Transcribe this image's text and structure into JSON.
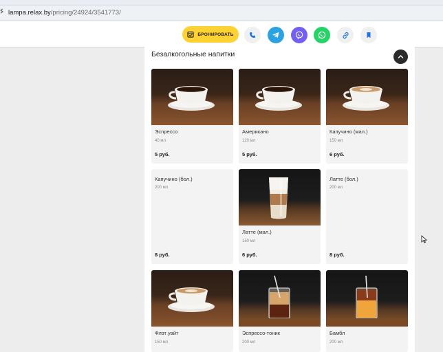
{
  "browser": {
    "url_host": "lampa.relax.by",
    "url_path": "/pricing/24924/3541773/"
  },
  "header": {
    "book_label": "БРОНИРОВАТЬ",
    "icons": [
      "phone-icon",
      "telegram-icon",
      "viber-icon",
      "whatsapp-icon",
      "link-icon",
      "bookmark-icon"
    ]
  },
  "section": {
    "title": "Безалкогольные напитки"
  },
  "items": [
    {
      "name": "Эспрессо",
      "volume": "40 мл",
      "price": "5 руб.",
      "photo": "coffee-cup"
    },
    {
      "name": "Американо",
      "volume": "120 мл",
      "price": "5 руб.",
      "photo": "coffee-cup"
    },
    {
      "name": "Капучино (мал.)",
      "volume": "150 мл",
      "price": "6 руб.",
      "photo": "latte-cup"
    },
    {
      "name": "Капучино (бол.)",
      "volume": "200 мл",
      "price": "8 руб.",
      "photo": ""
    },
    {
      "name": "Латте (мал.)",
      "volume": "150 мл",
      "price": "6 руб.",
      "photo": "latte-glass"
    },
    {
      "name": "Латте (бол.)",
      "volume": "200 мл",
      "price": "8 руб.",
      "photo": ""
    },
    {
      "name": "Флэт уайт",
      "volume": "150 мл",
      "price": "",
      "photo": "latte-cup"
    },
    {
      "name": "Эспрессо-тоник",
      "volume": "200 мл",
      "price": "",
      "photo": "tonic-glass"
    },
    {
      "name": "Бамбл",
      "volume": "200 мл",
      "price": "",
      "photo": "bumble-glass"
    }
  ],
  "colors": {
    "book_button": "#ffd233",
    "telegram": "#2aa3e0",
    "viber": "#7360f2",
    "whatsapp": "#25d366"
  }
}
